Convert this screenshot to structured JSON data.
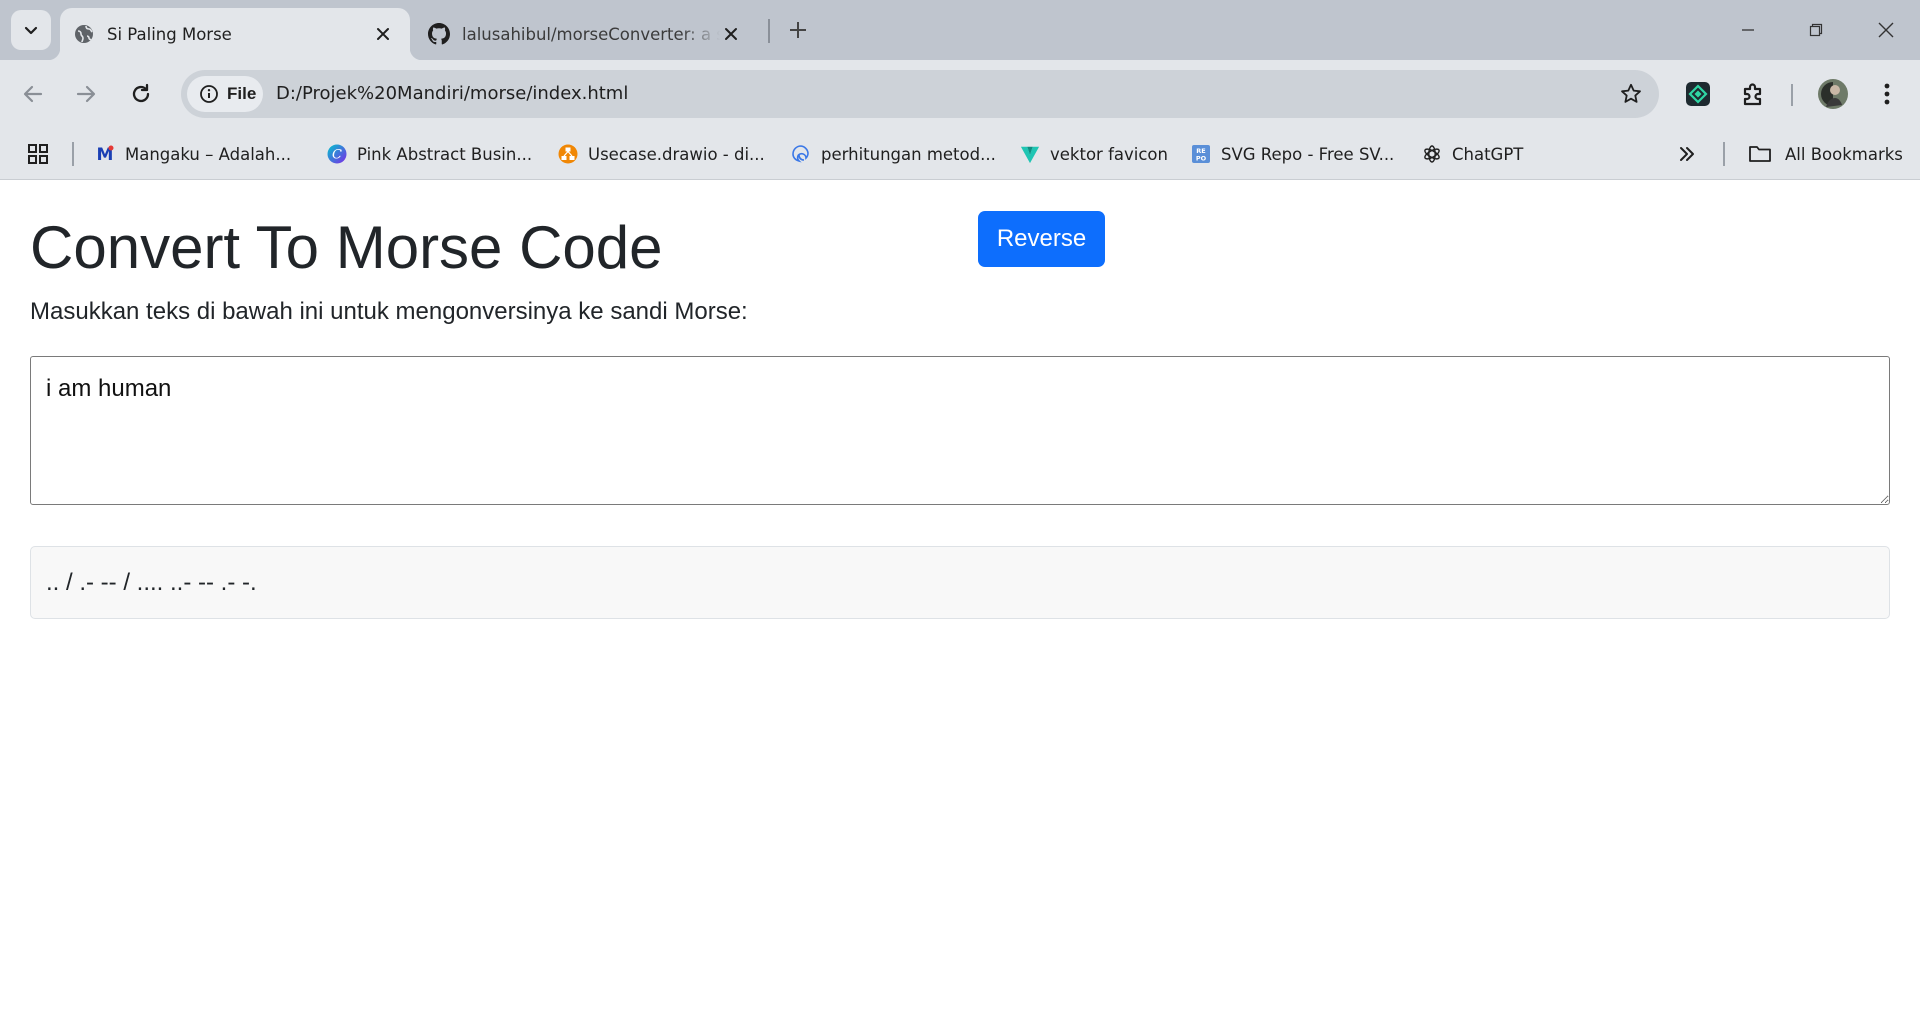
{
  "browser": {
    "tabs": [
      {
        "title": "Si Paling Morse",
        "active": true,
        "icon": "globe-icon"
      },
      {
        "title": "lalusahibul/morseConverter: a s",
        "active": false,
        "icon": "github-icon"
      }
    ],
    "address": {
      "chip_label": "File",
      "url": "D:/Projek%20Mandiri/morse/index.html"
    },
    "bookmarks": [
      {
        "label": "Mangaku – Adalah...",
        "icon": "mangaku-icon"
      },
      {
        "label": "Pink Abstract Busin...",
        "icon": "canva-icon"
      },
      {
        "label": "Usecase.drawio - di...",
        "icon": "drawio-icon"
      },
      {
        "label": "perhitungan metod...",
        "icon": "edge-icon"
      },
      {
        "label": "vektor favicon",
        "icon": "vector-icon"
      },
      {
        "label": "SVG Repo - Free SV...",
        "icon": "svgrepo-icon"
      },
      {
        "label": "ChatGPT",
        "icon": "chatgpt-icon"
      }
    ],
    "all_bookmarks_label": "All Bookmarks",
    "colors": {
      "chrome_bg": "#e3e6ea",
      "tabstrip_bg": "#bfc5ce"
    }
  },
  "page": {
    "heading": "Convert To Morse Code",
    "reverse_label": "Reverse",
    "description": "Masukkan teks di bawah ini untuk mengonversinya ke sandi Morse:",
    "input_value": "i am human",
    "output": ".. / .- -- / .... ..- -- .- -.",
    "colors": {
      "button": "#0d6efd",
      "text": "#212529",
      "output_bg": "#f8f8f8"
    }
  }
}
